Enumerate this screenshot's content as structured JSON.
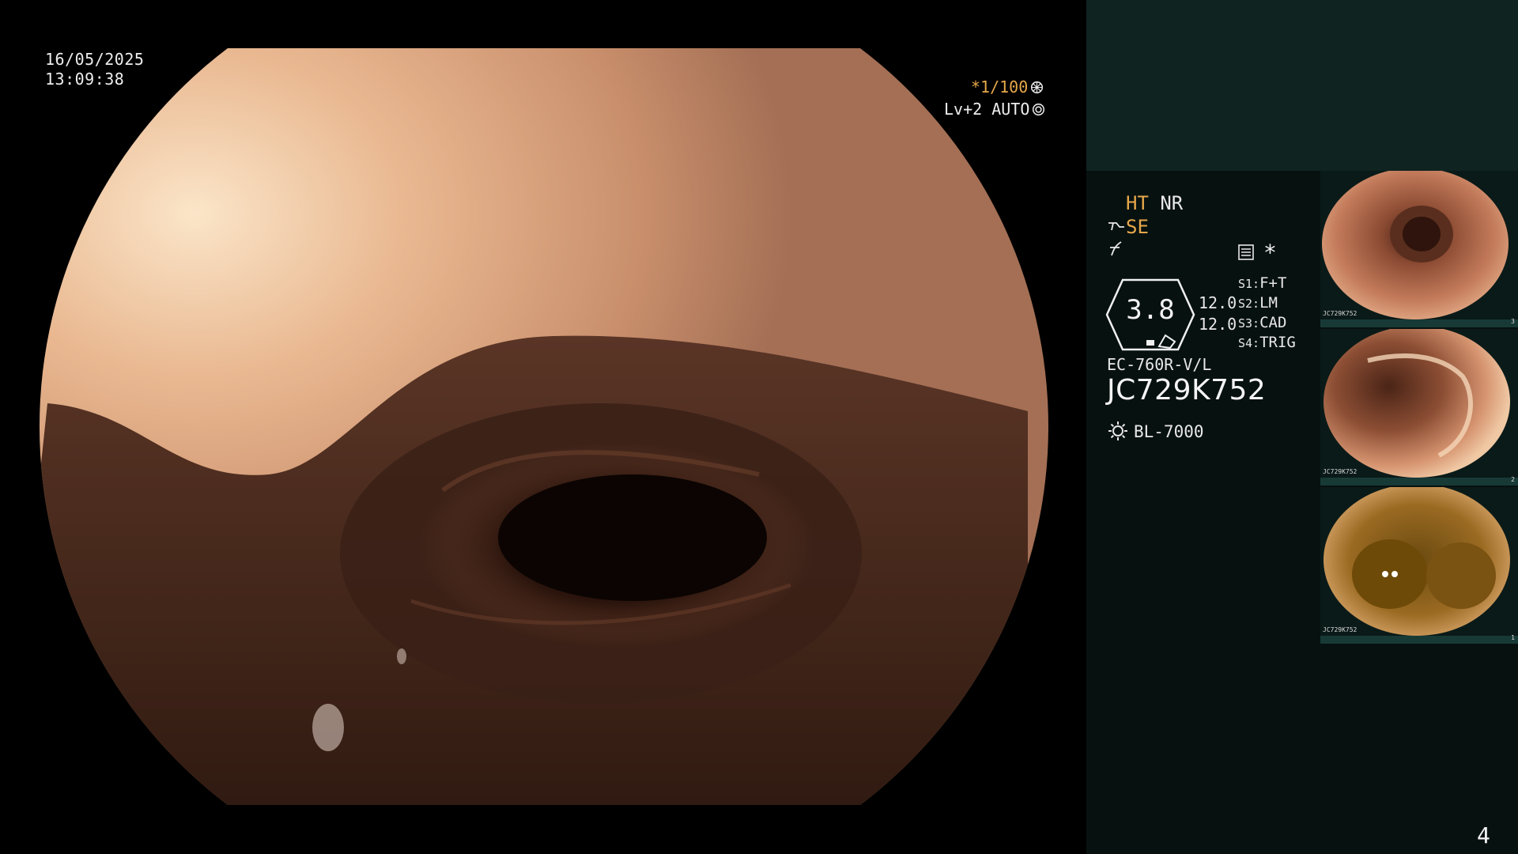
{
  "overlay": {
    "date": "16/05/2025",
    "time": "13:09:38",
    "shutter": "*1/100",
    "level": "Lv+2 AUTO"
  },
  "settings": {
    "ht": "HT",
    "nr": "NR",
    "se": "SE",
    "zoom": "3.8",
    "value_a": "12.0",
    "value_b": "12.0",
    "switches": [
      {
        "key": "S1:",
        "value": "F+T"
      },
      {
        "key": "S2:",
        "value": "LM"
      },
      {
        "key": "S3:",
        "value": "CAD"
      },
      {
        "key": "S4:",
        "value": "TRIG"
      }
    ],
    "scope_model": "EC-760R-V/L",
    "scope_serial": "JC729K752",
    "light_source": "BL-7000"
  },
  "thumbnails": [
    {
      "serial": "JC729K752",
      "index": "3"
    },
    {
      "serial": "JC729K752",
      "index": "2"
    },
    {
      "serial": "JC729K752",
      "index": "1"
    }
  ],
  "page_number": "4",
  "colors": {
    "accent_orange": "#e6a84a",
    "panel_top": "#0f2321",
    "panel_bottom": "#071110",
    "thumb_bar": "#173a36"
  },
  "icons": [
    "shutter-ring-icon",
    "auto-ring-icon",
    "scope-curve-icon",
    "freeze-icon",
    "document-icon",
    "star-icon",
    "sun-icon"
  ]
}
